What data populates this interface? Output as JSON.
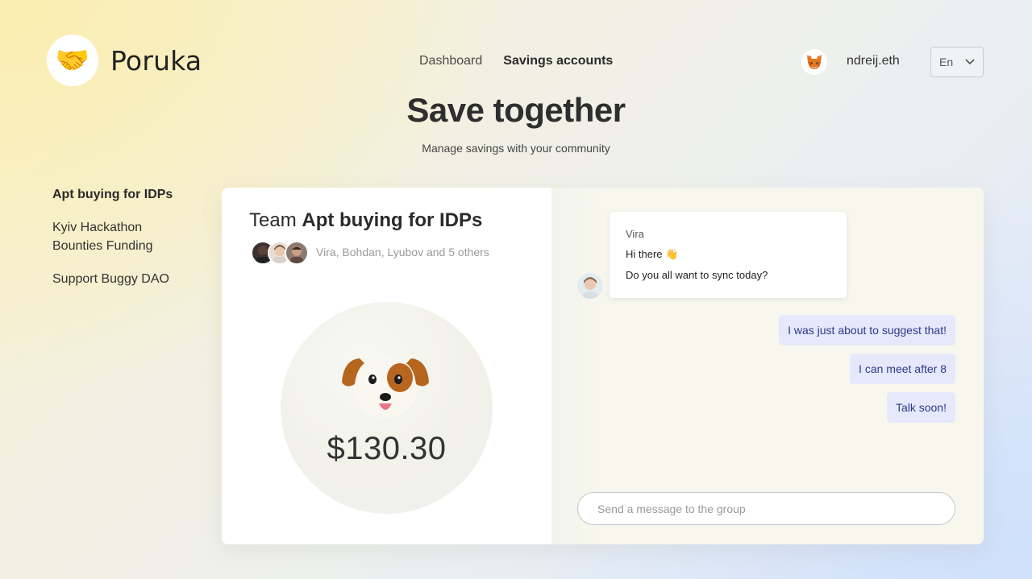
{
  "brand": {
    "name": "Poruka",
    "logo_icon": "handshake-icon",
    "logo_glyph": "🤝"
  },
  "nav": {
    "items": [
      {
        "label": "Dashboard",
        "active": false
      },
      {
        "label": "Savings accounts",
        "active": true
      }
    ]
  },
  "account": {
    "icon": "metamask-fox-icon",
    "name": "ndreij.eth"
  },
  "language": {
    "selected": "En"
  },
  "hero": {
    "title": "Save together",
    "subtitle": "Manage savings with your community"
  },
  "sidebar": {
    "items": [
      {
        "label": "Apt buying for IDPs",
        "active": true
      },
      {
        "label": "Kyiv Hackathon Bounties Funding",
        "active": false
      },
      {
        "label": "Support Buggy DAO",
        "active": false
      }
    ]
  },
  "team": {
    "title_prefix": "Team",
    "title_name": "Apt buying for IDPs",
    "members_text": "Vira, Bohdan, Lyubov and 5 others",
    "avatar_colors": [
      "#3a3330",
      "#c9b6a8",
      "#7a6a62"
    ],
    "balance": "$130.30",
    "pig_icon": "dog-face-icon"
  },
  "chat": {
    "incoming": {
      "sender": "Vira",
      "lines": [
        "Hi there 👋",
        "Do you all want to sync today?"
      ]
    },
    "outgoing": [
      "I was just about to suggest that!",
      "I can meet after 8",
      "Talk soon!"
    ],
    "input_placeholder": "Send a message to the group"
  },
  "colors": {
    "accent_bubble": "#e6e8fb",
    "accent_text": "#2e3a8c",
    "fox_orange": "#e2761b"
  }
}
